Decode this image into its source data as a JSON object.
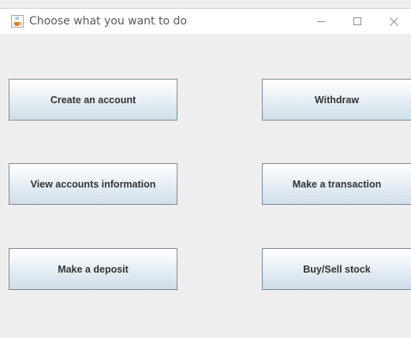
{
  "window": {
    "title": "Choose what you want to do",
    "app_icon": "java-cup-icon",
    "controls": {
      "minimize_icon": "minimize-icon",
      "maximize_icon": "maximize-icon",
      "close_icon": "close-icon"
    }
  },
  "buttons": {
    "create_account": "Create an account",
    "withdraw": "Withdraw",
    "view_accounts": "View accounts information",
    "make_transaction": "Make a transaction",
    "make_deposit": "Make a deposit",
    "buy_sell_stock": "Buy/Sell stock"
  },
  "colors": {
    "button_border": "#7a8a99",
    "button_gradient_top": "#ffffff",
    "button_gradient_bottom": "#cfdde9",
    "background": "#eeeeee",
    "titlebar": "#ffffff"
  }
}
